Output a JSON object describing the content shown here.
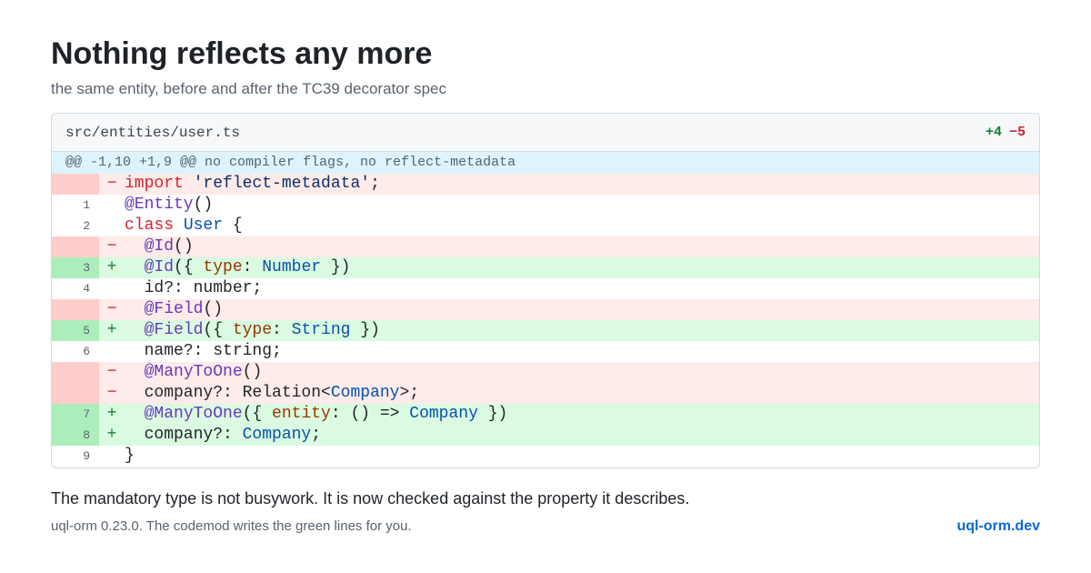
{
  "page": {
    "title": "Nothing reflects any more",
    "subtitle": "the same entity, before and after the TC39 decorator spec"
  },
  "diff": {
    "file_name": "src/entities/user.ts",
    "additions": "+4",
    "deletions": "−5",
    "hunk": "@@ -1,10 +1,9 @@ no compiler flags, no reflect-metadata",
    "lines": [
      {
        "type": "del",
        "ln": "",
        "marker": "−",
        "tokens": [
          {
            "c": "kw",
            "t": "import"
          },
          {
            "c": "plain",
            "t": " "
          },
          {
            "c": "str",
            "t": "'reflect-metadata'"
          },
          {
            "c": "plain",
            "t": ";"
          }
        ]
      },
      {
        "type": "ctx",
        "ln": "1",
        "marker": "",
        "tokens": [
          {
            "c": "dec",
            "t": "@Entity"
          },
          {
            "c": "plain",
            "t": "()"
          }
        ]
      },
      {
        "type": "ctx",
        "ln": "2",
        "marker": "",
        "tokens": [
          {
            "c": "kw",
            "t": "class"
          },
          {
            "c": "plain",
            "t": " "
          },
          {
            "c": "cls",
            "t": "User"
          },
          {
            "c": "plain",
            "t": " {"
          }
        ]
      },
      {
        "type": "del",
        "ln": "",
        "marker": "−",
        "tokens": [
          {
            "c": "plain",
            "t": "  "
          },
          {
            "c": "dec",
            "t": "@Id"
          },
          {
            "c": "plain",
            "t": "()"
          }
        ]
      },
      {
        "type": "add",
        "ln": "3",
        "marker": "+",
        "tokens": [
          {
            "c": "plain",
            "t": "  "
          },
          {
            "c": "dec",
            "t": "@Id"
          },
          {
            "c": "plain",
            "t": "({ "
          },
          {
            "c": "prop",
            "t": "type"
          },
          {
            "c": "plain",
            "t": ": "
          },
          {
            "c": "typ",
            "t": "Number"
          },
          {
            "c": "plain",
            "t": " })"
          }
        ]
      },
      {
        "type": "ctx",
        "ln": "4",
        "marker": "",
        "tokens": [
          {
            "c": "plain",
            "t": "  id?: number;"
          }
        ]
      },
      {
        "type": "del",
        "ln": "",
        "marker": "−",
        "tokens": [
          {
            "c": "plain",
            "t": "  "
          },
          {
            "c": "dec",
            "t": "@Field"
          },
          {
            "c": "plain",
            "t": "()"
          }
        ]
      },
      {
        "type": "add",
        "ln": "5",
        "marker": "+",
        "tokens": [
          {
            "c": "plain",
            "t": "  "
          },
          {
            "c": "dec",
            "t": "@Field"
          },
          {
            "c": "plain",
            "t": "({ "
          },
          {
            "c": "prop",
            "t": "type"
          },
          {
            "c": "plain",
            "t": ": "
          },
          {
            "c": "typ",
            "t": "String"
          },
          {
            "c": "plain",
            "t": " })"
          }
        ]
      },
      {
        "type": "ctx",
        "ln": "6",
        "marker": "",
        "tokens": [
          {
            "c": "plain",
            "t": "  name?: string;"
          }
        ]
      },
      {
        "type": "del",
        "ln": "",
        "marker": "−",
        "tokens": [
          {
            "c": "plain",
            "t": "  "
          },
          {
            "c": "dec",
            "t": "@ManyToOne"
          },
          {
            "c": "plain",
            "t": "()"
          }
        ]
      },
      {
        "type": "del",
        "ln": "",
        "marker": "−",
        "tokens": [
          {
            "c": "plain",
            "t": "  company?: Relation<"
          },
          {
            "c": "typ",
            "t": "Company"
          },
          {
            "c": "plain",
            "t": ">;"
          }
        ]
      },
      {
        "type": "add",
        "ln": "7",
        "marker": "+",
        "tokens": [
          {
            "c": "plain",
            "t": "  "
          },
          {
            "c": "dec",
            "t": "@ManyToOne"
          },
          {
            "c": "plain",
            "t": "({ "
          },
          {
            "c": "prop",
            "t": "entity"
          },
          {
            "c": "plain",
            "t": ": () => "
          },
          {
            "c": "typ",
            "t": "Company"
          },
          {
            "c": "plain",
            "t": " })"
          }
        ]
      },
      {
        "type": "add",
        "ln": "8",
        "marker": "+",
        "tokens": [
          {
            "c": "plain",
            "t": "  company?: "
          },
          {
            "c": "typ",
            "t": "Company"
          },
          {
            "c": "plain",
            "t": ";"
          }
        ]
      },
      {
        "type": "ctx",
        "ln": "9",
        "marker": "",
        "tokens": [
          {
            "c": "plain",
            "t": "}"
          }
        ]
      }
    ]
  },
  "note": "The mandatory type is not busywork. It is now checked against the property it describes.",
  "footer": {
    "left": "uql-orm 0.23.0. The codemod writes the green lines for you.",
    "right": "uql-orm.dev"
  },
  "colors": {
    "add_bg": "#dafbe1",
    "del_bg": "#ffebe9",
    "hunk_bg": "#ddf4ff",
    "link": "#0969da"
  }
}
